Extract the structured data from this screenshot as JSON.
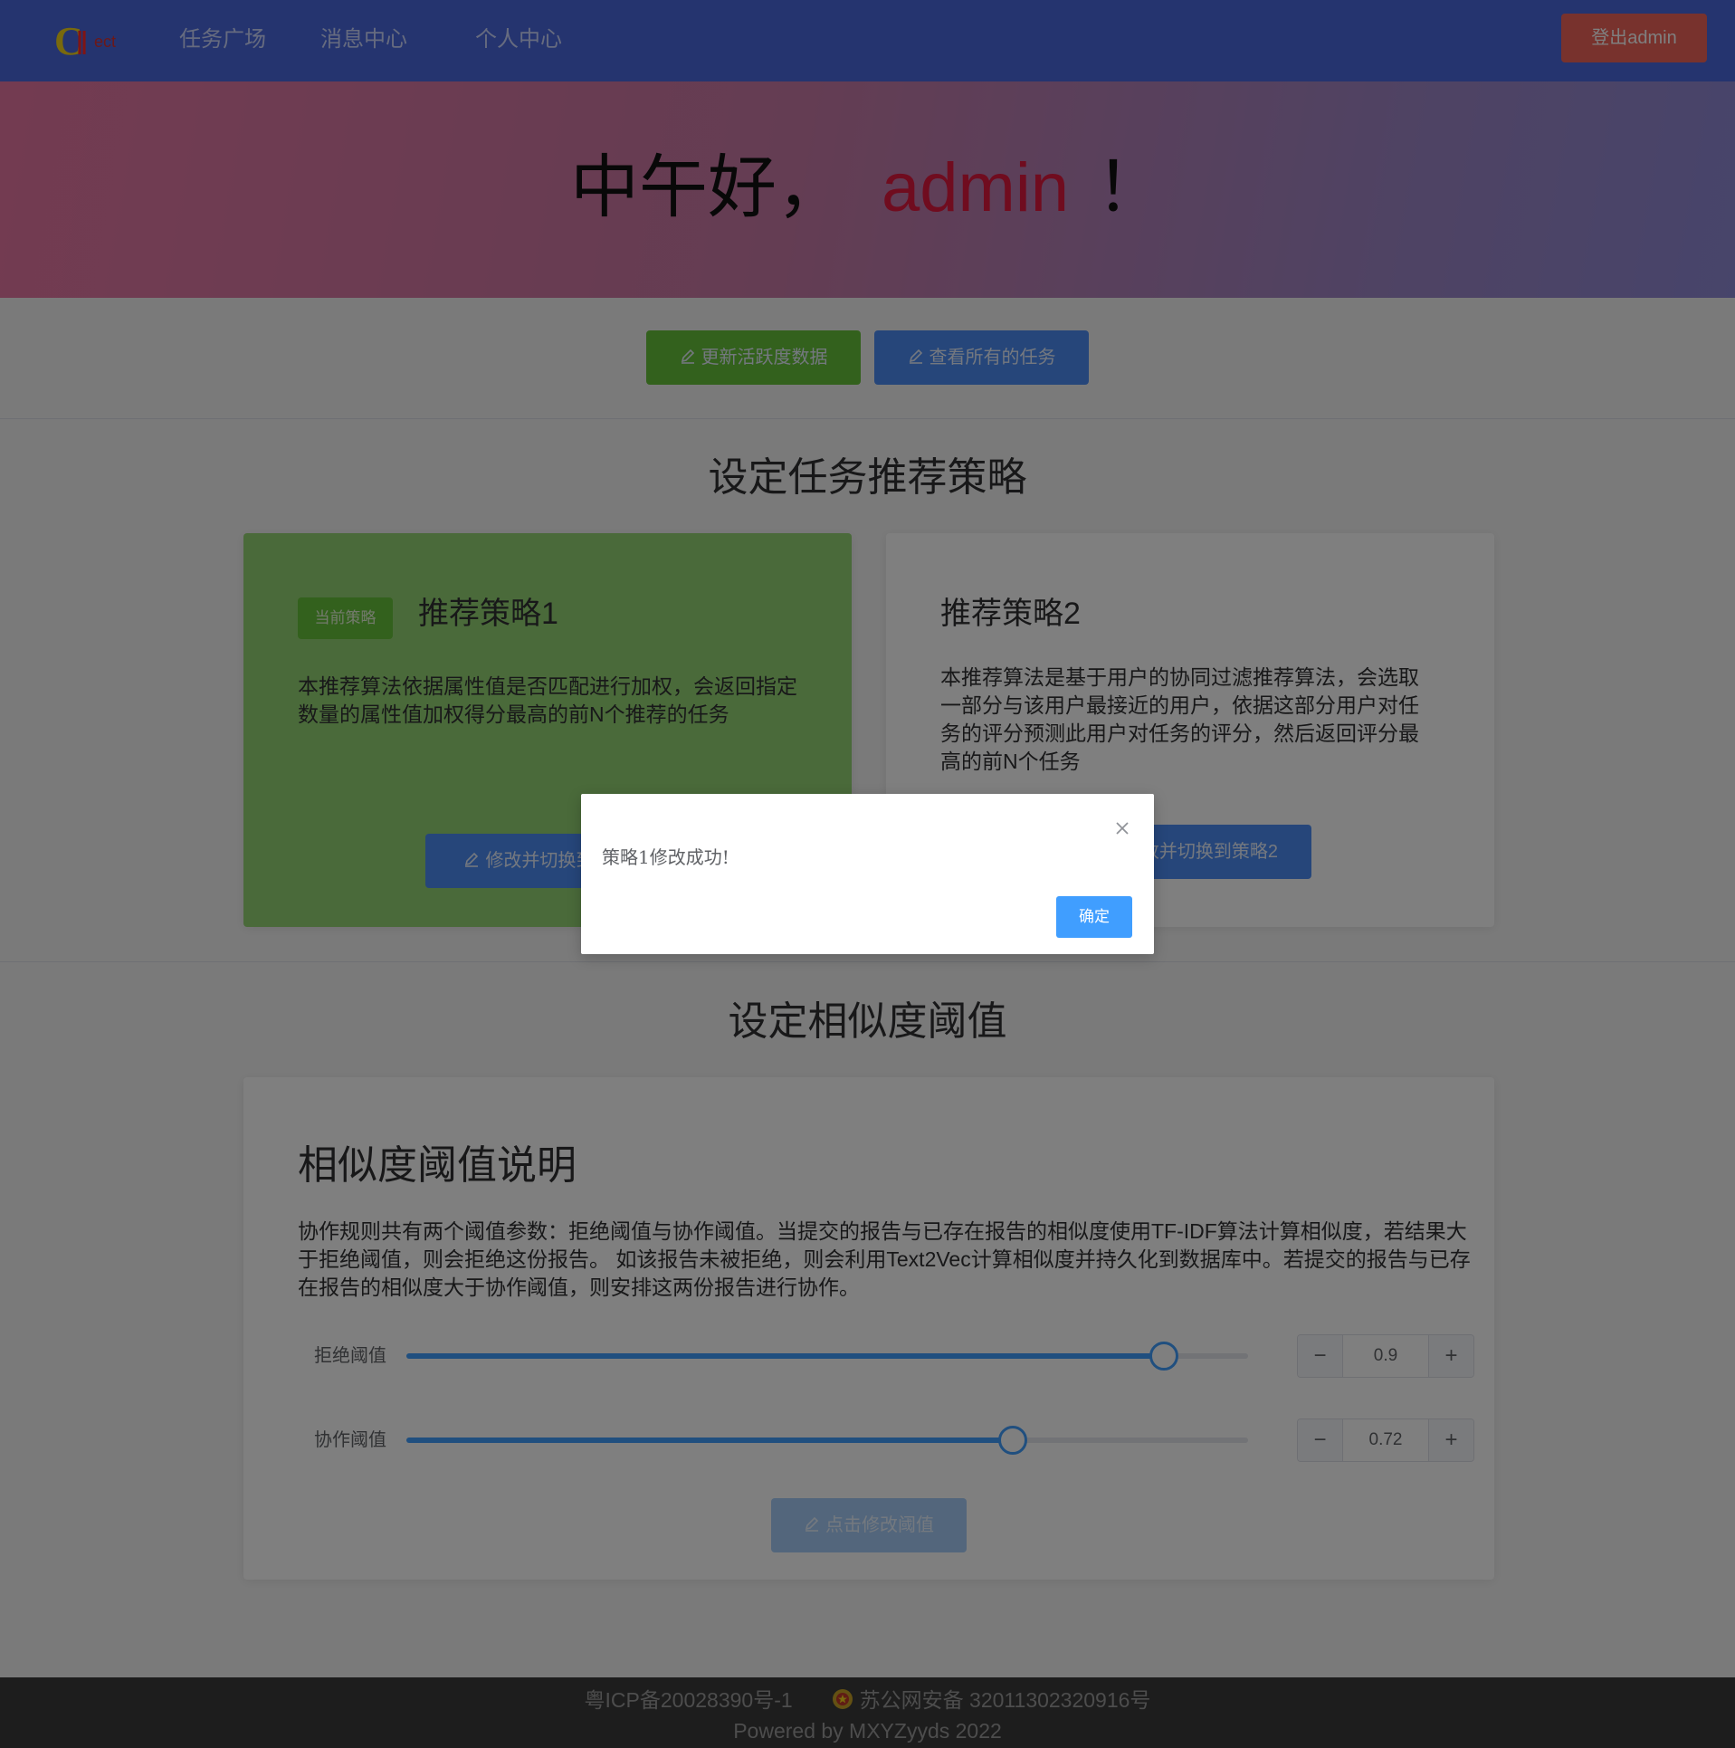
{
  "brand": {
    "logo_text": "Collect"
  },
  "nav": {
    "items": [
      {
        "label": "任务广场"
      },
      {
        "label": "消息中心"
      },
      {
        "label": "个人中心"
      }
    ],
    "logout_label": "登出admin"
  },
  "hero": {
    "greeting": "中午好，",
    "username": "admin",
    "exclamation": "！"
  },
  "actions": {
    "update_activity_label": "更新活跃度数据",
    "view_all_tasks_label": "查看所有的任务"
  },
  "strategy_section": {
    "title": "设定任务推荐策略",
    "cards": [
      {
        "tag": "当前策略",
        "title": "推荐策略1",
        "description": "本推荐算法依据属性值是否匹配进行加权，会返回指定数量的属性值加权得分最高的前N个推荐的任务",
        "button_label": "修改并切换到策略1",
        "is_current": true
      },
      {
        "title": "推荐策略2",
        "description": "本推荐算法是基于用户的协同过滤推荐算法，会选取一部分与该用户最接近的用户，依据这部分用户对任务的评分预测此用户对任务的评分，然后返回评分最高的前N个任务",
        "button_label": "修改并切换到策略2",
        "is_current": false
      }
    ]
  },
  "threshold_section": {
    "title": "设定相似度阈值",
    "card_title": "相似度阈值说明",
    "description": "协作规则共有两个阈值参数：拒绝阈值与协作阈值。当提交的报告与已存在报告的相似度使用TF-IDF算法计算相似度，若结果大于拒绝阈值，则会拒绝这份报告。 如该报告未被拒绝，则会利用Text2Vec计算相似度并持久化到数据库中。若提交的报告与已存在报告的相似度大于协作阈值，则安排这两份报告进行协作。",
    "sliders": [
      {
        "label": "拒绝阈值",
        "value": 0.9,
        "display": "0.9",
        "min": 0,
        "max": 1
      },
      {
        "label": "协作阈值",
        "value": 0.72,
        "display": "0.72",
        "min": 0,
        "max": 1
      }
    ],
    "submit_label": "点击修改阈值"
  },
  "footer": {
    "icp": "粤ICP备20028390号-1",
    "police": "苏公网安备 32011302320916号",
    "powered_by": "Powered by MXYZyyds 2022"
  },
  "dialog": {
    "message": "策略1修改成功!",
    "ok_label": "确定"
  },
  "colors": {
    "navbar": "#4a68de",
    "success": "#67c23a",
    "primary": "#409eff",
    "danger": "#f0645a",
    "username": "#e0193f"
  },
  "icons": {
    "button_icon": "edit-pen-icon",
    "dialog_close": "close-icon",
    "footer_badge": "police-badge-icon"
  }
}
